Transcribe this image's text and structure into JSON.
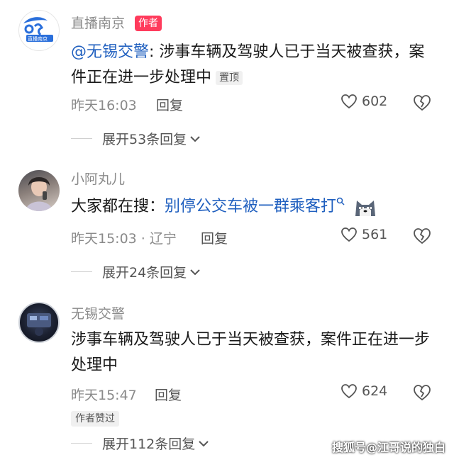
{
  "comments": [
    {
      "username": "直播南京",
      "author_tag": "作者",
      "mention": "@无锡交警",
      "text": ": 涉事车辆及驾驶人已于当天被查获，案件正在进一步处理中",
      "pin_tag": "置顶",
      "time": "昨天16:03",
      "reply_label": "回复",
      "likes": "602",
      "expand_label": "展开53条回复"
    },
    {
      "username": "小阿丸儿",
      "search_prefix": "大家都在搜：",
      "search_term": "别停公交车被一群乘客打",
      "time": "昨天15:03 · 辽宁",
      "reply_label": "回复",
      "likes": "561",
      "expand_label": "展开24条回复"
    },
    {
      "username": "无锡交警",
      "text": "涉事车辆及驾驶人已于当天被查获，案件正在进一步处理中",
      "time": "昨天15:47",
      "reply_label": "回复",
      "likes": "624",
      "liked_by_author": "作者赞过",
      "expand_label": "展开112条回复"
    }
  ],
  "avatar_logo_text": "直播南京",
  "watermark": "搜狐号@江哥说的独白",
  "colors": {
    "author_tag": "#ff3b5c",
    "link": "#1f5fbf",
    "muted": "#8a8a8a"
  }
}
